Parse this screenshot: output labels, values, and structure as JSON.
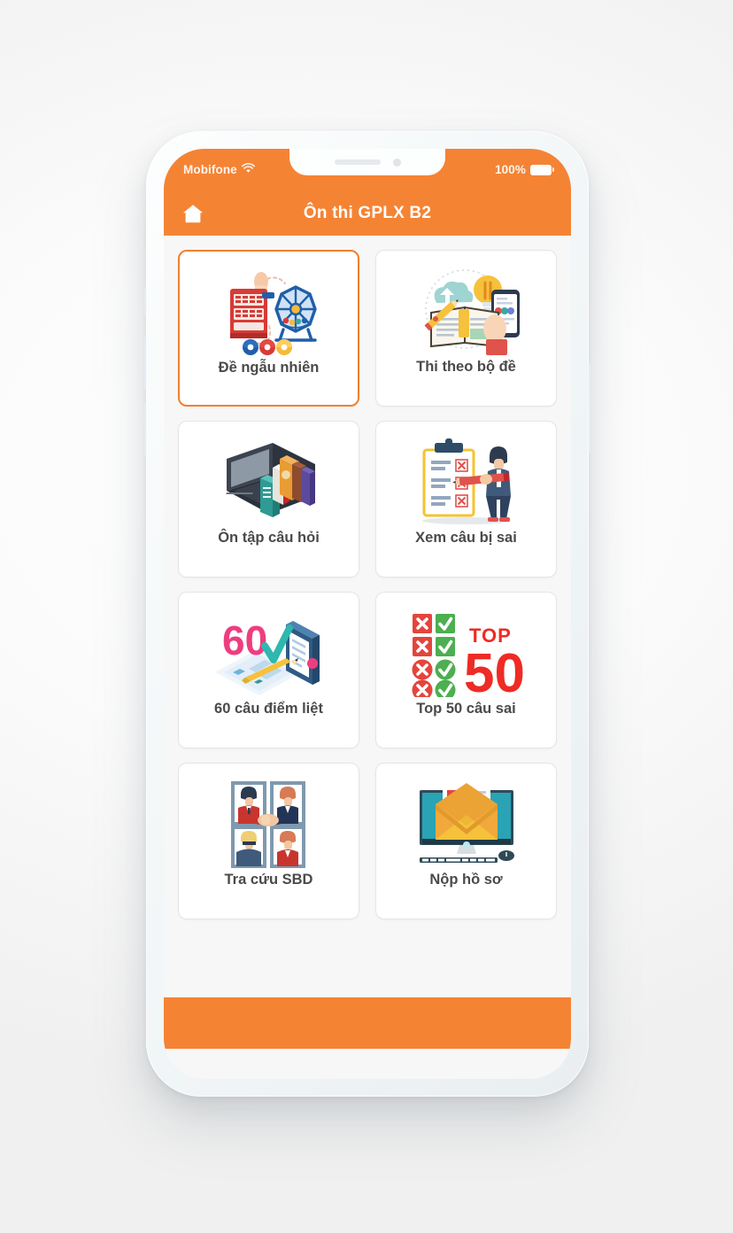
{
  "status_bar": {
    "carrier": "Mobifone",
    "wifi_icon": "wifi-icon",
    "battery_percent": "100%",
    "battery_icon": "battery-full-icon"
  },
  "app_bar": {
    "home_icon": "home-icon",
    "title": "Ôn thi GPLX B2"
  },
  "colors": {
    "accent_orange": "#F58334",
    "selected_border": "#F08030",
    "screen_background": "#f7f7f7",
    "tile_background": "#ffffff",
    "tile_border": "#e3e5e7",
    "label_text": "#4a4a4a"
  },
  "main": {
    "tiles": [
      {
        "label": "Đề ngẫu nhiên",
        "icon": "lottery-wheel-icon",
        "selected": true
      },
      {
        "label": "Thi theo bộ đề",
        "icon": "book-lightbulb-icon",
        "selected": false
      },
      {
        "label": "Ôn tập câu hỏi",
        "icon": "laptop-books-icon",
        "selected": false
      },
      {
        "label": "Xem câu bị sai",
        "icon": "clipboard-person-icon",
        "selected": false
      },
      {
        "label": "60 câu điểm liệt",
        "icon": "sixty-checklist-icon",
        "selected": false
      },
      {
        "label": "Top 50 câu sai",
        "icon": "top50-checkmarks-icon",
        "selected": false
      },
      {
        "label": "Tra cứu SBD",
        "icon": "people-portraits-icon",
        "selected": false
      },
      {
        "label": "Nộp hồ sơ",
        "icon": "monitor-envelope-icon",
        "selected": false
      }
    ]
  }
}
